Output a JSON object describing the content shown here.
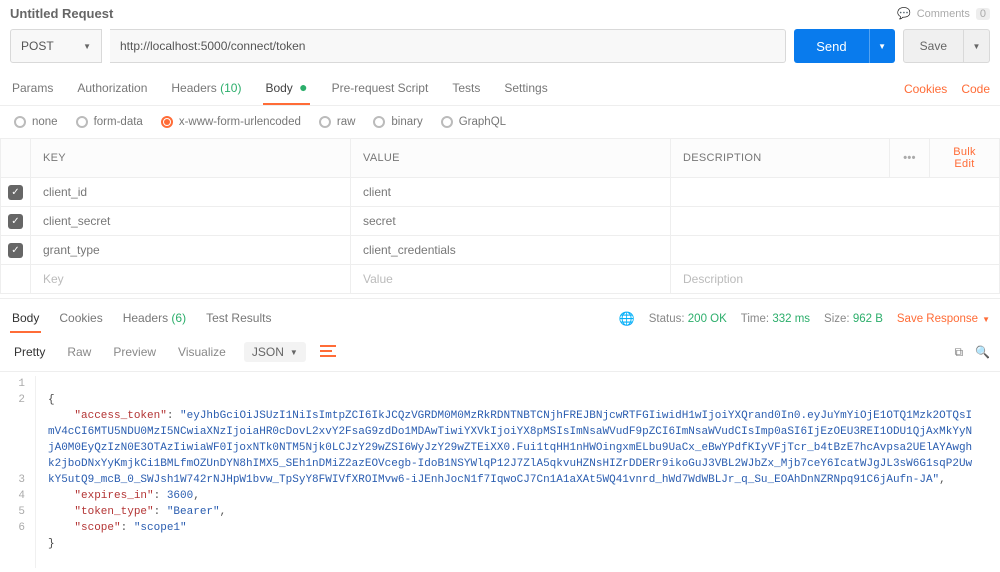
{
  "header": {
    "title": "Untitled Request",
    "comments_label": "Comments",
    "comments_count": "0"
  },
  "request": {
    "method": "POST",
    "url": "http://localhost:5000/connect/token",
    "send_label": "Send",
    "save_label": "Save"
  },
  "tabs": {
    "params": "Params",
    "authorization": "Authorization",
    "headers": "Headers",
    "headers_count": "(10)",
    "body": "Body",
    "prerequest": "Pre-request Script",
    "tests": "Tests",
    "settings": "Settings",
    "cookies_link": "Cookies",
    "code_link": "Code"
  },
  "body_types": {
    "none": "none",
    "formdata": "form-data",
    "xwww": "x-www-form-urlencoded",
    "raw": "raw",
    "binary": "binary",
    "graphql": "GraphQL"
  },
  "kv": {
    "key_h": "KEY",
    "value_h": "VALUE",
    "desc_h": "DESCRIPTION",
    "bulk": "Bulk Edit",
    "rows": [
      {
        "key": "client_id",
        "value": "client"
      },
      {
        "key": "client_secret",
        "value": "secret"
      },
      {
        "key": "grant_type",
        "value": "client_credentials"
      }
    ],
    "ph_key": "Key",
    "ph_value": "Value",
    "ph_desc": "Description"
  },
  "response": {
    "body_tab": "Body",
    "cookies_tab": "Cookies",
    "headers_tab": "Headers",
    "headers_count": "(6)",
    "test_results": "Test Results",
    "status_label": "Status:",
    "status_value": "200 OK",
    "time_label": "Time:",
    "time_value": "332 ms",
    "size_label": "Size:",
    "size_value": "962 B",
    "save_response": "Save Response"
  },
  "viewer": {
    "pretty": "Pretty",
    "raw": "Raw",
    "preview": "Preview",
    "visualize": "Visualize",
    "json": "JSON"
  },
  "json_lines": {
    "l1": "{",
    "l2_key": "\"access_token\"",
    "l2_val": "\"eyJhbGciOiJSUzI1NiIsImtpZCI6IkJCQzVGRDM0M0MzRkRDNTNBTCNjhFREJBNjcwRTFGIiwidH1wIjoiYXQrand0In0.eyJuYmYiOjE1OTQ1Mzk2OTQsImV4cCI6MTU5NDU0MzI5NCwiaXNzIjoiaHR0cDovL2xvY2FsaG9zdDo1MDAwTiwiYXVkIjoiYX8pMSIsImNsaWVudF9pZCI6ImNsaWVudCIsImp0aSI6IjEzOEU3REI1ODU1QjAxMkYyNjA0M0EyQzIzN0E3OTAzIiwiaWF0IjoxNTk0NTM5Njk0LCJzY29wZSI6WyJzY29wZTEiXX0.Fui1tqHH1nHWOingxmELbu9UaCx_eBwYPdfKIyVFjTcr_b4tBzE7hcAvpsa2UElAYAwghk2jboDNxYyKmjkCi1BMLfmOZUnDYN8hIMX5_SEh1nDMiZ2azEOVcegb-IdoB1NSYWlqP12J7ZlA5qkvuHZNsHIZrDDERr9ikoGuJ3VBL2WJbZx_Mjb7ceY6IcatWJgJL3sW6G1sqP2UwkY5utQ9_mcB_0_SWJsh1W742rNJHpW1bvw_TpSyY8FWIVfXROIMvw6-iJEnhJocN1f7IqwoCJ7Cn1A1aXAt5WQ41vnrd_hWd7WdWBLJr_q_Su_EOAhDnNZRNpq91C6jAufn-JA\"",
    "l3_key": "\"expires_in\"",
    "l3_val": "3600",
    "l4_key": "\"token_type\"",
    "l4_val": "\"Bearer\"",
    "l5_key": "\"scope\"",
    "l5_val": "\"scope1\"",
    "l6": "}"
  }
}
